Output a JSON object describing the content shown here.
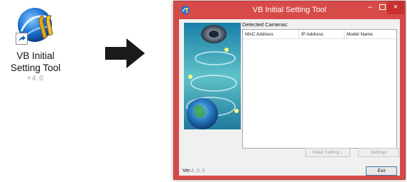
{
  "shortcut": {
    "label_line1": "VB Initial",
    "label_line2": "Setting Tool",
    "version": "+4.0",
    "icon": "vb-tool-icon",
    "overlay_icon": "shortcut-arrow-icon"
  },
  "flow": {
    "icon": "right-arrow-icon",
    "color": "#1a1a1a"
  },
  "window": {
    "title": "VB Initial Setting Tool",
    "accent": "#d64a48",
    "controls": {
      "minimize": "–",
      "close": "×"
    },
    "detected_label": "Detected Cameras:",
    "columns": [
      "MAC Address",
      "IP Address",
      "Model Name"
    ],
    "buttons": {
      "initial_setting": "Initial Setting...",
      "settings": "Settings",
      "exit": "Exit"
    },
    "version_prefix": "Ver.",
    "version_value": "4.0.0"
  }
}
